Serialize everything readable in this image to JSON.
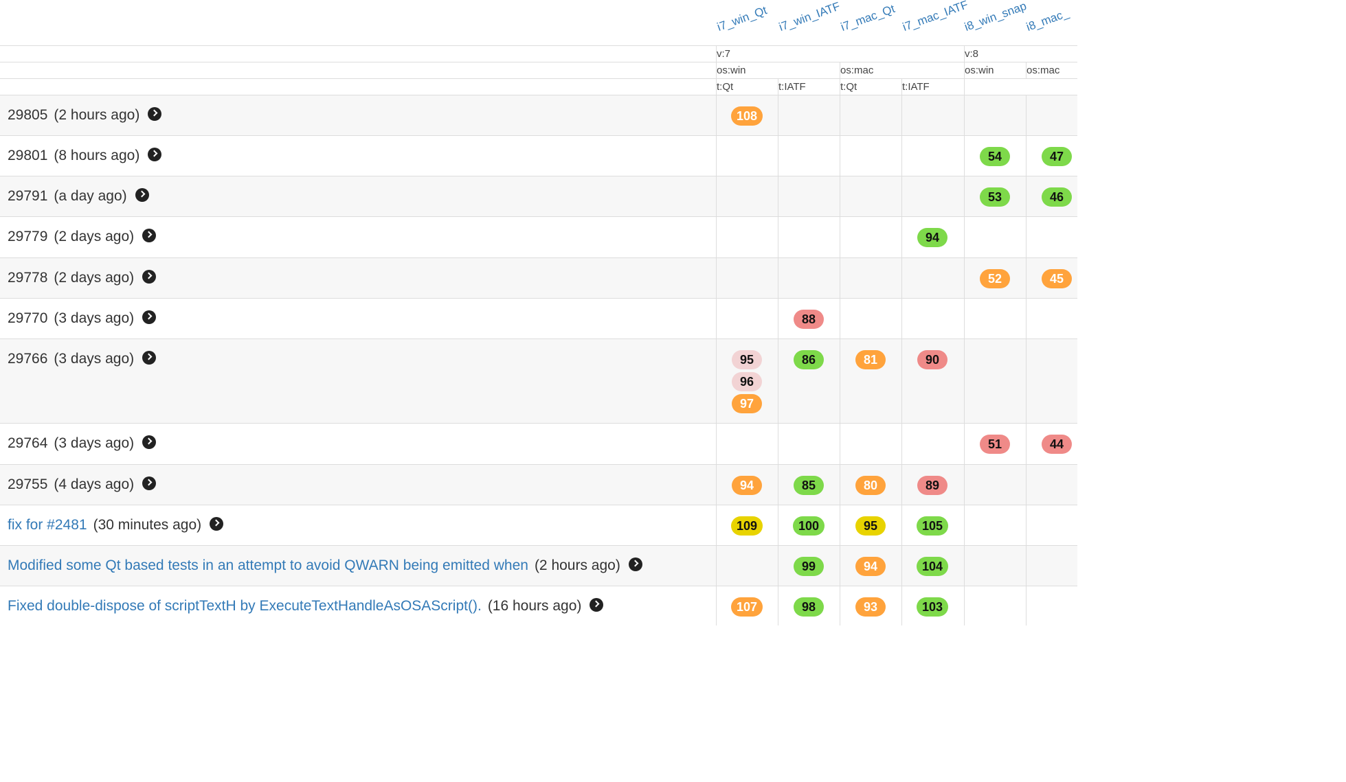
{
  "columns": [
    "i7_win_Qt",
    "i7_win_IATF",
    "i7_mac_Qt",
    "i7_mac_IATF",
    "i8_win_snap",
    "i8_mac_"
  ],
  "header_rows": {
    "version": [
      {
        "label": "v:7"
      },
      {
        "label": "v:8"
      }
    ],
    "os": [
      {
        "label": "os:win"
      },
      {
        "label": "os:mac"
      },
      {
        "label": "os:win"
      },
      {
        "label": "os:mac"
      }
    ],
    "type": [
      {
        "label": "t:Qt"
      },
      {
        "label": "t:IATF"
      },
      {
        "label": "t:Qt"
      },
      {
        "label": "t:IATF"
      }
    ]
  },
  "colors": {
    "orange": "#ffa33c",
    "green": "#7ed94a",
    "red": "#ef8a88",
    "pink": "#f2d3d4",
    "yellow": "#e8d300",
    "link": "#337ab7"
  },
  "rows": [
    {
      "rev": "29805",
      "ago": "(2 hours ago)",
      "cells": [
        [
          {
            "v": "108",
            "c": "orange"
          }
        ],
        [],
        [],
        [],
        [],
        []
      ]
    },
    {
      "rev": "29801",
      "ago": "(8 hours ago)",
      "cells": [
        [],
        [],
        [],
        [],
        [
          {
            "v": "54",
            "c": "green"
          }
        ],
        [
          {
            "v": "47",
            "c": "green"
          }
        ]
      ]
    },
    {
      "rev": "29791",
      "ago": "(a day ago)",
      "cells": [
        [],
        [],
        [],
        [],
        [
          {
            "v": "53",
            "c": "green"
          }
        ],
        [
          {
            "v": "46",
            "c": "green"
          }
        ]
      ]
    },
    {
      "rev": "29779",
      "ago": "(2 days ago)",
      "cells": [
        [],
        [],
        [],
        [
          {
            "v": "94",
            "c": "green"
          }
        ],
        [],
        []
      ]
    },
    {
      "rev": "29778",
      "ago": "(2 days ago)",
      "cells": [
        [],
        [],
        [],
        [],
        [
          {
            "v": "52",
            "c": "orange"
          }
        ],
        [
          {
            "v": "45",
            "c": "orange"
          }
        ]
      ]
    },
    {
      "rev": "29770",
      "ago": "(3 days ago)",
      "cells": [
        [],
        [
          {
            "v": "88",
            "c": "red"
          }
        ],
        [],
        [],
        [],
        []
      ]
    },
    {
      "rev": "29766",
      "ago": "(3 days ago)",
      "cells": [
        [
          {
            "v": "95",
            "c": "pink"
          },
          {
            "v": "96",
            "c": "pink"
          },
          {
            "v": "97",
            "c": "orange"
          }
        ],
        [
          {
            "v": "86",
            "c": "green"
          }
        ],
        [
          {
            "v": "81",
            "c": "orange"
          }
        ],
        [
          {
            "v": "90",
            "c": "red"
          }
        ],
        [],
        []
      ]
    },
    {
      "rev": "29764",
      "ago": "(3 days ago)",
      "cells": [
        [],
        [],
        [],
        [],
        [
          {
            "v": "51",
            "c": "red"
          }
        ],
        [
          {
            "v": "44",
            "c": "red"
          }
        ]
      ]
    },
    {
      "rev": "29755",
      "ago": "(4 days ago)",
      "cells": [
        [
          {
            "v": "94",
            "c": "orange"
          }
        ],
        [
          {
            "v": "85",
            "c": "green"
          }
        ],
        [
          {
            "v": "80",
            "c": "orange"
          }
        ],
        [
          {
            "v": "89",
            "c": "red"
          }
        ],
        [],
        []
      ]
    },
    {
      "link": "fix for #2481",
      "ago": "(30 minutes ago)",
      "cells": [
        [
          {
            "v": "109",
            "c": "yellow"
          }
        ],
        [
          {
            "v": "100",
            "c": "green"
          }
        ],
        [
          {
            "v": "95",
            "c": "yellow"
          }
        ],
        [
          {
            "v": "105",
            "c": "green"
          }
        ],
        [],
        []
      ]
    },
    {
      "link": "Modified some Qt based tests in an attempt to avoid QWARN being emitted when",
      "ago": "(2 hours ago)",
      "cells": [
        [],
        [
          {
            "v": "99",
            "c": "green"
          }
        ],
        [
          {
            "v": "94",
            "c": "orange"
          }
        ],
        [
          {
            "v": "104",
            "c": "green"
          }
        ],
        [],
        []
      ]
    },
    {
      "link": "Fixed double-dispose of scriptTextH by ExecuteTextHandleAsOSAScript().",
      "ago": "(16 hours ago)",
      "cells": [
        [
          {
            "v": "107",
            "c": "orange"
          }
        ],
        [
          {
            "v": "98",
            "c": "green"
          }
        ],
        [
          {
            "v": "93",
            "c": "orange"
          }
        ],
        [
          {
            "v": "103",
            "c": "green"
          }
        ],
        [],
        []
      ]
    }
  ]
}
